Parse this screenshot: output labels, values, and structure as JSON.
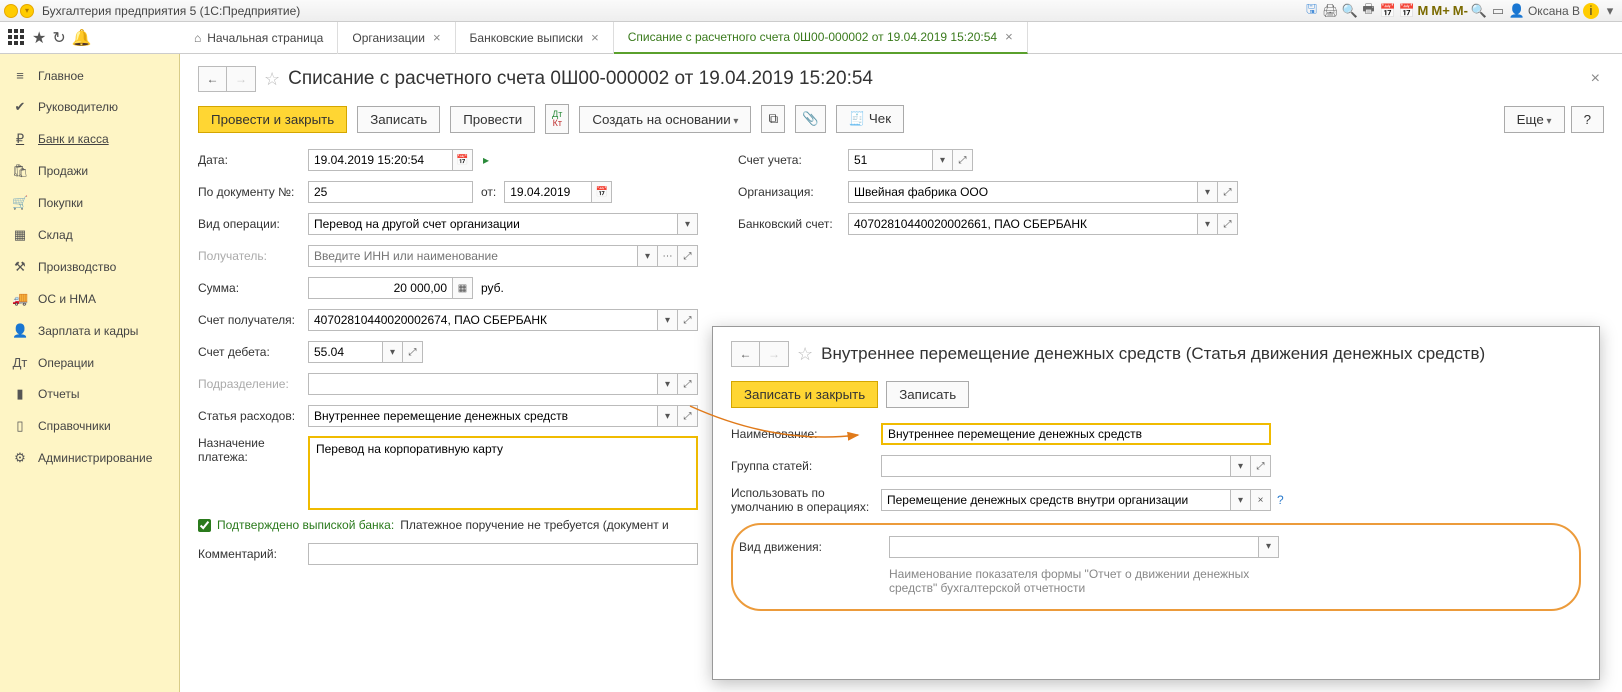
{
  "titlebar": {
    "text": "Бухгалтерия предприятия 5   (1С:Предприятие)",
    "user": "Оксана В",
    "M": "M",
    "Mplus": "M+",
    "Mminus": "M-"
  },
  "tabs": {
    "home": "Начальная страница",
    "org": "Организации",
    "bank": "Банковские выписки",
    "active": "Списание с расчетного счета 0Ш00-000002 от 19.04.2019 15:20:54"
  },
  "sidebar": [
    {
      "icon": "≡",
      "label": "Главное"
    },
    {
      "icon": "✔",
      "label": "Руководителю"
    },
    {
      "icon": "₽",
      "label": "Банк и касса",
      "active": true
    },
    {
      "icon": "🛍",
      "label": "Продажи"
    },
    {
      "icon": "🛒",
      "label": "Покупки"
    },
    {
      "icon": "▦",
      "label": "Склад"
    },
    {
      "icon": "⚒",
      "label": "Производство"
    },
    {
      "icon": "🚚",
      "label": "ОС и НМА"
    },
    {
      "icon": "👤",
      "label": "Зарплата и кадры"
    },
    {
      "icon": "Дт",
      "label": "Операции"
    },
    {
      "icon": "▮",
      "label": "Отчеты"
    },
    {
      "icon": "▯",
      "label": "Справочники"
    },
    {
      "icon": "⚙",
      "label": "Администрирование"
    }
  ],
  "doc": {
    "title": "Списание с расчетного счета 0Ш00-000002 от 19.04.2019 15:20:54",
    "toolbar": {
      "post_close": "Провести и закрыть",
      "save": "Записать",
      "post": "Провести",
      "create_based": "Создать на основании",
      "receipt": "Чек",
      "more": "Еще",
      "help": "?"
    },
    "fields": {
      "date_label": "Дата:",
      "date": "19.04.2019 15:20:54",
      "docnum_label": "По документу №:",
      "docnum": "25",
      "from_label": "от:",
      "docdate": "19.04.2019",
      "optype_label": "Вид операции:",
      "optype": "Перевод на другой счет организации",
      "payee_label": "Получатель:",
      "payee_placeholder": "Введите ИНН или наименование",
      "sum_label": "Сумма:",
      "sum": "20 000,00",
      "sum_unit": "руб.",
      "recacct_label": "Счет получателя:",
      "recacct": "40702810440020002674, ПАО СБЕРБАНК",
      "debacct_label": "Счет дебета:",
      "debacct": "55.04",
      "dept_label": "Подразделение:",
      "expitem_label": "Статья расходов:",
      "expitem": "Внутреннее перемещение денежных средств",
      "purpose_label": "Назначение\nплатежа:",
      "purpose": "Перевод на корпоративную карту",
      "confirm_label": "Подтверждено выпиской банка:",
      "confirm_text": "Платежное поручение не требуется (документ и",
      "comment_label": "Комментарий:",
      "account_label": "Счет учета:",
      "account": "51",
      "org_label": "Организация:",
      "org": "Швейная фабрика ООО",
      "bankacct_label": "Банковский счет:",
      "bankacct": "40702810440020002661, ПАО СБЕРБАНК"
    }
  },
  "popup": {
    "title": "Внутреннее перемещение денежных средств (Статья движения денежных средств)",
    "save_close": "Записать и закрыть",
    "save": "Записать",
    "name_label": "Наименование:",
    "name": "Внутреннее перемещение денежных средств",
    "group_label": "Группа статей:",
    "usedef_label": "Использовать по умолчанию в операциях:",
    "usedef": "Перемещение денежных средств внутри организации",
    "movetype_label": "Вид движения:",
    "hint": "Наименование показателя формы \"Отчет о движении денежных средств\" бухгалтерской отчетности",
    "q": "?"
  }
}
